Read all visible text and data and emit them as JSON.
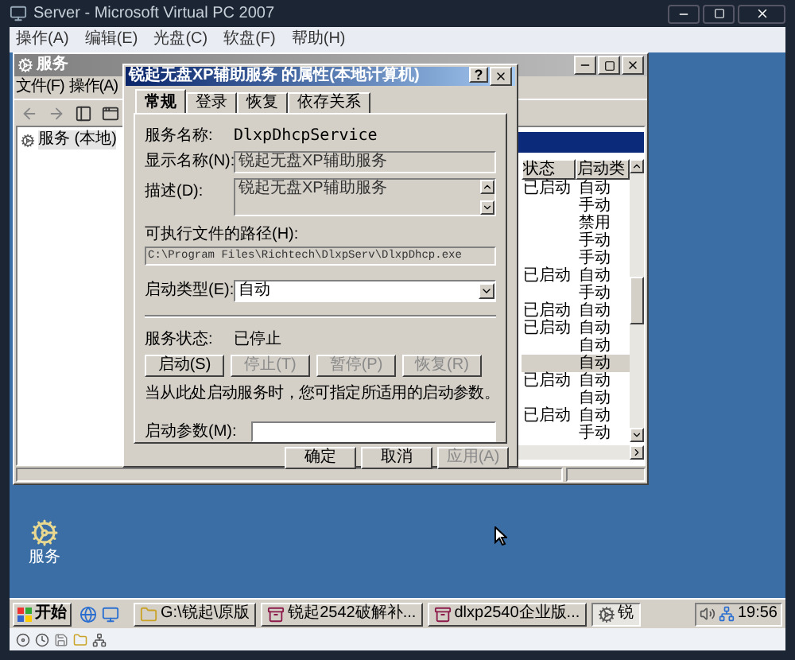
{
  "host_window": {
    "title": "Server - Microsoft Virtual PC 2007"
  },
  "host_menu": [
    "操作(A)",
    "编辑(E)",
    "光盘(C)",
    "软盘(F)",
    "帮助(H)"
  ],
  "services_window": {
    "title": "服务",
    "menu": [
      "文件(F)",
      "操作(A)"
    ],
    "tree": [
      "服务 (本地)"
    ],
    "columns": [
      "状态",
      "启动类"
    ],
    "rows": [
      {
        "status": "已启动",
        "startup": "自动",
        "selected": false
      },
      {
        "status": "",
        "startup": "手动",
        "selected": false
      },
      {
        "status": "",
        "startup": "禁用",
        "selected": false
      },
      {
        "status": "",
        "startup": "手动",
        "selected": false
      },
      {
        "status": "",
        "startup": "手动",
        "selected": false
      },
      {
        "status": "已启动",
        "startup": "自动",
        "selected": false
      },
      {
        "status": "",
        "startup": "手动",
        "selected": false
      },
      {
        "status": "已启动",
        "startup": "自动",
        "selected": false
      },
      {
        "status": "已启动",
        "startup": "自动",
        "selected": false
      },
      {
        "status": "",
        "startup": "自动",
        "selected": false
      },
      {
        "status": "",
        "startup": "自动",
        "selected": true
      },
      {
        "status": "已启动",
        "startup": "自动",
        "selected": false
      },
      {
        "status": "",
        "startup": "自动",
        "selected": false
      },
      {
        "status": "已启动",
        "startup": "自动",
        "selected": false
      },
      {
        "status": "",
        "startup": "手动",
        "selected": false
      }
    ]
  },
  "dialog": {
    "title": "锐起无盘XP辅助服务 的属性(本地计算机)",
    "help": "?",
    "tabs": [
      {
        "label": "常规",
        "selected": true
      },
      {
        "label": "登录",
        "selected": false
      },
      {
        "label": "恢复",
        "selected": false
      },
      {
        "label": "依存关系",
        "selected": false
      }
    ],
    "service_name_label": "服务名称:",
    "service_name": "DlxpDhcpService",
    "display_name_label": "显示名称(N):",
    "display_name": "锐起无盘XP辅助服务",
    "description_label": "描述(D):",
    "description": "锐起无盘XP辅助服务",
    "path_label": "可执行文件的路径(H):",
    "path": "C:\\Program Files\\Richtech\\DlxpServ\\DlxpDhcp.exe",
    "startup_type_label": "启动类型(E):",
    "startup_type": "自动",
    "status_label": "服务状态:",
    "status": "已停止",
    "control_buttons": [
      {
        "label": "启动(S)",
        "disabled": false
      },
      {
        "label": "停止(T)",
        "disabled": true
      },
      {
        "label": "暂停(P)",
        "disabled": true
      },
      {
        "label": "恢复(R)",
        "disabled": true
      }
    ],
    "hint": "当从此处启动服务时，您可指定所适用的启动参数。",
    "params_label": "启动参数(M):",
    "footer_buttons": [
      {
        "label": "确定",
        "disabled": false
      },
      {
        "label": "取消",
        "disabled": false
      },
      {
        "label": "应用(A)",
        "disabled": true
      }
    ]
  },
  "desktop_icons": [
    {
      "label": "服务"
    }
  ],
  "taskbar": {
    "start": "开始",
    "tasks": [
      {
        "label": "G:\\锐起\\原版",
        "kind": "folder",
        "selected": false
      },
      {
        "label": "锐起2542破解补...",
        "kind": "archive",
        "selected": false
      },
      {
        "label": "dlxp2540企业版...",
        "kind": "archive",
        "selected": false
      },
      {
        "label": "锐",
        "kind": "services",
        "selected": true
      }
    ],
    "clock": "19:56"
  }
}
